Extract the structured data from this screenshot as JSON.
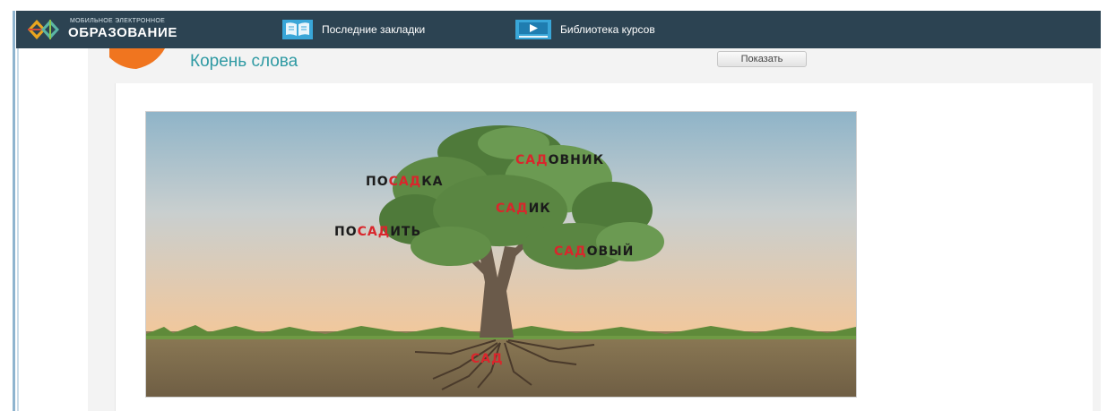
{
  "header": {
    "logo_small": "МОБИЛЬНОЕ ЭЛЕКТРОННОЕ",
    "logo_big": "ОБРАЗОВАНИЕ",
    "nav": [
      {
        "label": "Последние закладки",
        "icon": "bookmarks-book-icon"
      },
      {
        "label": "Библиотека курсов",
        "icon": "video-library-icon"
      }
    ]
  },
  "lesson": {
    "title": "Корень слова",
    "show_button": "Показать"
  },
  "illustration": {
    "words": [
      {
        "prefix": "ПО",
        "root": "САД",
        "suffix": "КА"
      },
      {
        "prefix": "",
        "root": "САД",
        "suffix": "ОВНИК"
      },
      {
        "prefix": "",
        "root": "САД",
        "suffix": "ИК"
      },
      {
        "prefix": "ПО",
        "root": "САД",
        "suffix": "ИТЬ"
      },
      {
        "prefix": "",
        "root": "САД",
        "suffix": "ОВЫЙ"
      },
      {
        "prefix": "",
        "root": "САД",
        "suffix": ""
      }
    ]
  },
  "colors": {
    "header_bg": "#2c4352",
    "title": "#2f9aa3",
    "root_highlight": "#d9262c",
    "accent_orange": "#f0751f"
  }
}
